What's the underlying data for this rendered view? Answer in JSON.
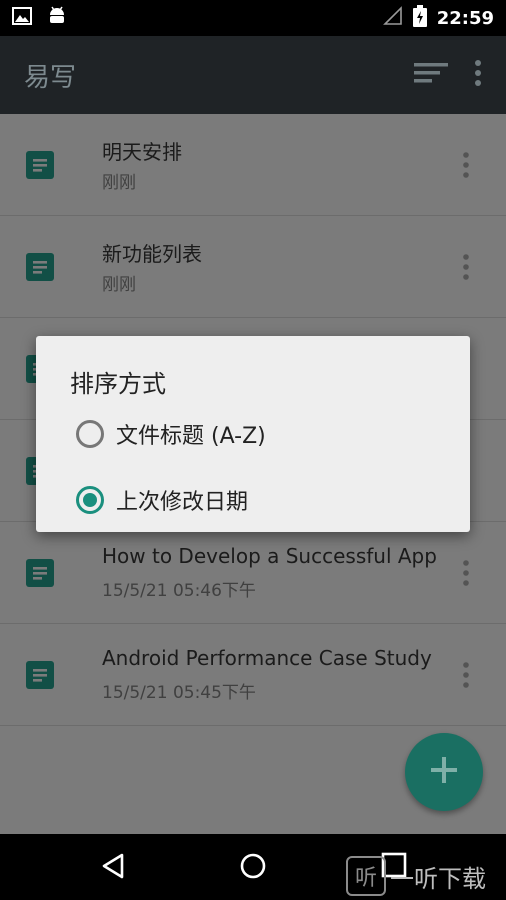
{
  "status_bar": {
    "time": "22:59"
  },
  "app_bar": {
    "title": "易写"
  },
  "notes": [
    {
      "title": "明天安排",
      "time": "刚刚"
    },
    {
      "title": "新功能列表",
      "time": "刚刚"
    },
    {
      "title": "",
      "time": ""
    },
    {
      "title": "",
      "time": ""
    },
    {
      "title": "How to Develop a Successful App",
      "time": "15/5/21 05:46下午"
    },
    {
      "title": "Android Performance Case Study",
      "time": "15/5/21 05:45下午"
    }
  ],
  "dialog": {
    "title": "排序方式",
    "options": [
      {
        "label": "文件标题 (A-Z)",
        "selected": false
      },
      {
        "label": "上次修改日期",
        "selected": true
      }
    ]
  },
  "watermark": {
    "text": "一听下载",
    "logo": "听"
  },
  "colors": {
    "accent": "#1a8f7e",
    "app_bar": "#1f2326",
    "fab": "#1a6f62"
  }
}
